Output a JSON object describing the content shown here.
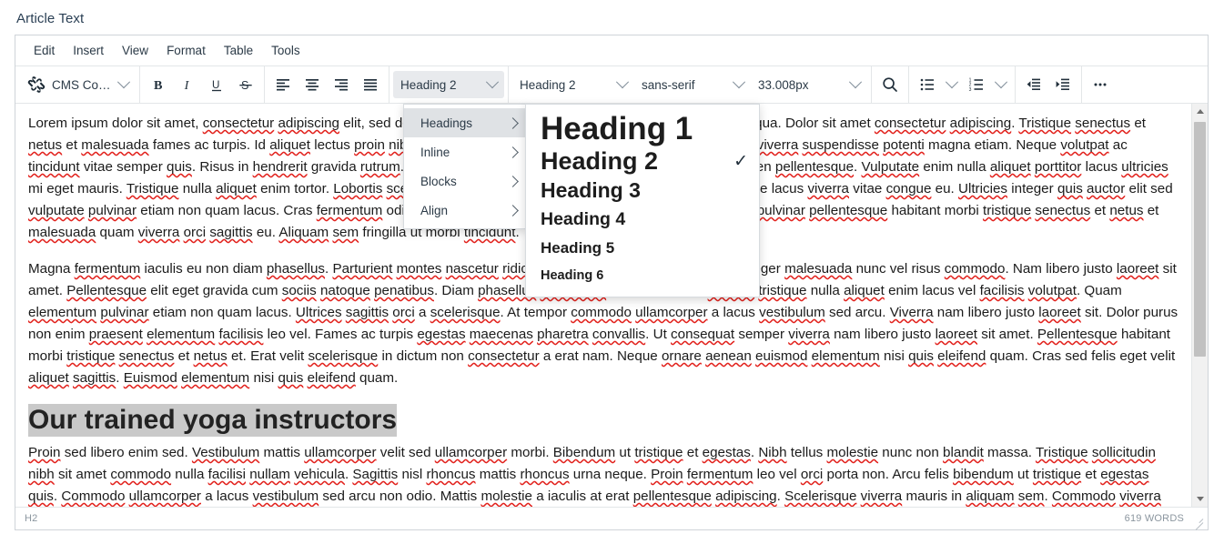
{
  "field": {
    "label": "Article Text"
  },
  "menubar": {
    "items": [
      {
        "label": "Edit"
      },
      {
        "label": "Insert"
      },
      {
        "label": "View"
      },
      {
        "label": "Format"
      },
      {
        "label": "Table"
      },
      {
        "label": "Tools"
      }
    ]
  },
  "toolbar": {
    "cms_content": {
      "label": "CMS Content",
      "icon": "joomla-icon"
    },
    "bold": {
      "label": "B",
      "icon": "bold-icon"
    },
    "italic": {
      "label": "I",
      "icon": "italic-icon"
    },
    "underline": {
      "label": "U",
      "icon": "underline-icon"
    },
    "strikethrough": {
      "label": "S",
      "icon": "strikethrough-icon"
    },
    "align_left": {
      "icon": "align-left-icon"
    },
    "align_center": {
      "icon": "align-center-icon"
    },
    "align_right": {
      "icon": "align-right-icon"
    },
    "align_justify": {
      "icon": "align-justify-icon"
    },
    "format_select": {
      "value": "Heading 2"
    },
    "block_select": {
      "value": "Heading 2"
    },
    "font_select": {
      "value": "sans-serif"
    },
    "fontsize_select": {
      "value": "33.008px"
    },
    "search": {
      "icon": "search-icon"
    },
    "bullet_list": {
      "icon": "bullet-list-icon"
    },
    "numbered_list": {
      "icon": "numbered-list-icon"
    },
    "outdent": {
      "icon": "outdent-icon"
    },
    "indent": {
      "icon": "indent-icon"
    },
    "more": {
      "label": "...",
      "icon": "more-options-icon"
    }
  },
  "format_menu": {
    "items": [
      {
        "label": "Headings",
        "has_submenu": true,
        "selected": true
      },
      {
        "label": "Inline",
        "has_submenu": true,
        "selected": false
      },
      {
        "label": "Blocks",
        "has_submenu": true,
        "selected": false
      },
      {
        "label": "Align",
        "has_submenu": true,
        "selected": false
      }
    ]
  },
  "headings_menu": {
    "items": [
      {
        "label": "Heading 1",
        "checked": false
      },
      {
        "label": "Heading 2",
        "checked": true
      },
      {
        "label": "Heading 3",
        "checked": false
      },
      {
        "label": "Heading 4",
        "checked": false
      },
      {
        "label": "Heading 5",
        "checked": false
      },
      {
        "label": "Heading 6",
        "checked": false
      }
    ],
    "check_glyph": "✓"
  },
  "content": {
    "paragraph1": "Lorem ipsum dolor sit amet, consectetur adipiscing elit, sed do eiusmod tempor incididunt ut labore et dolore magna aliqua. Dolor sit amet consectetur adipiscing. Tristique senectus et netus et malesuada fames ac turpis. Id aliquet lectus proin nibh nisl condimentum id venenatis. Id velit ut tortor pretium viverra suspendisse potenti magna etiam. Neque volutpat ac tincidunt vitae semper quis. Risus in hendrerit gravida rutrum. Nisl condimentum id venenatis a condimentum vitae sapien pellentesque. Vulputate enim nulla aliquet porttitor lacus ultricies mi eget mauris. Tristique nulla aliquet enim tortor. Lobortis scelerisque fermentum dui faucibus. In iaculis nunc sed augue lacus viverra vitae congue eu. Ultricies integer quis auctor elit sed vulputate pulvinar etiam non quam lacus. Cras fermentum odio eu feugiat pretium nibh ipsum consequat. Pellentesque pulvinar pellentesque habitant morbi tristique senectus et netus et malesuada quam viverra orci sagittis eu. Aliquam sem fringilla ut morbi tincidunt.",
    "paragraph2": "Magna fermentum iaculis eu non diam phasellus. Parturient montes nascetur ridiculus mus mauris vitae ultricies leo integer malesuada nunc vel risus commodo. Nam libero justo laoreet sit amet. Pellentesque elit eget gravida cum sociis natoque penatibus. Diam phasellus vestibulum lorem sed risus ultricies tristique nulla aliquet enim lacus vel facilisis volutpat. Quam elementum pulvinar etiam non quam lacus. Ultrices sagittis orci a scelerisque. At tempor commodo ullamcorper a lacus vestibulum sed arcu. Viverra nam libero justo laoreet sit. Dolor purus non enim praesent elementum facilisis leo vel. Fames ac turpis egestas maecenas pharetra convallis. Ut consequat semper viverra nam libero justo laoreet sit amet. Pellentesque habitant morbi tristique senectus et netus et. Erat velit scelerisque in dictum non consectetur a erat nam. Neque ornare aenean euismod elementum nisi quis eleifend quam. Cras sed felis eget velit aliquet sagittis. Euismod elementum nisi quis eleifend quam.",
    "heading": "Our trained yoga instructors",
    "paragraph3": "Proin sed libero enim sed. Vestibulum mattis ullamcorper velit sed ullamcorper morbi. Bibendum ut tristique et egestas. Nibh tellus molestie nunc non blandit massa. Tristique sollicitudin nibh sit amet commodo nulla facilisi nullam vehicula. Sagittis nisl rhoncus mattis rhoncus urna neque. Proin fermentum leo vel orci porta non. Arcu felis bibendum ut tristique et egestas quis. Commodo ullamcorper a lacus vestibulum sed arcu non odio. Mattis molestie a iaculis at erat pellentesque adipiscing. Scelerisque viverra mauris in aliquam sem. Commodo viverra maecenas accumsan lacus vel facilisis. Facilisi cras fermentum odio eu feugiat pretium. Massa ultricies mi quis hendrerit dolor magna eget."
  },
  "statusbar": {
    "element_path": "H2",
    "word_count": "619 WORDS"
  },
  "colors": {
    "label": "#2a3f54",
    "spellcheck_underline": "#e2211c",
    "selection": "#c9c9c9",
    "border": "#cfd4d9"
  }
}
